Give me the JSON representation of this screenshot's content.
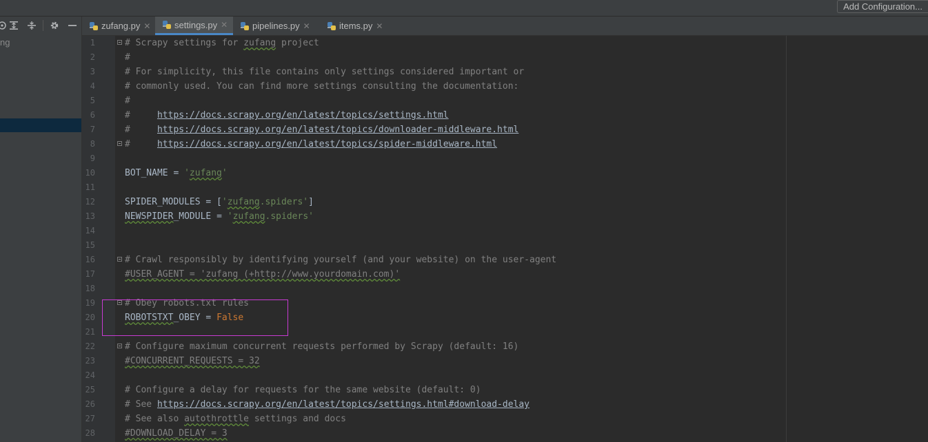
{
  "window": {
    "add_config_label": "Add Configuration..."
  },
  "sidebar": {
    "truncated_label": "ng"
  },
  "tabs": [
    {
      "label": "zufang.py",
      "active": false
    },
    {
      "label": "settings.py",
      "active": true
    },
    {
      "label": "pipelines.py",
      "active": false
    },
    {
      "label": "items.py",
      "active": false
    }
  ],
  "icons": {
    "tab_file": "python-file-icon",
    "tab_close": "close-icon",
    "toolbar": [
      "locate-icon",
      "expand-all-icon",
      "collapse-all-icon",
      "gear-icon",
      "minimize-icon"
    ]
  },
  "colors": {
    "comment": "#808080",
    "string": "#6a8759",
    "keyword": "#cc7832",
    "identifier": "#a9b7c6",
    "highlight_box": "#c93bd4"
  },
  "editor": {
    "lines": [
      {
        "n": "1",
        "segs": [
          [
            "c",
            "# Scrapy settings for "
          ],
          [
            "csq",
            "zufang"
          ],
          [
            "c",
            " project"
          ]
        ]
      },
      {
        "n": "2",
        "segs": [
          [
            "c",
            "#"
          ]
        ]
      },
      {
        "n": "3",
        "segs": [
          [
            "c",
            "# For simplicity, this file contains only settings considered important or"
          ]
        ]
      },
      {
        "n": "4",
        "segs": [
          [
            "c",
            "# commonly used. You can find more settings consulting the documentation:"
          ]
        ]
      },
      {
        "n": "5",
        "segs": [
          [
            "c",
            "#"
          ]
        ]
      },
      {
        "n": "6",
        "segs": [
          [
            "c",
            "#     "
          ],
          [
            "u",
            "https://docs.scrapy.org/en/latest/topics/settings.html"
          ]
        ]
      },
      {
        "n": "7",
        "segs": [
          [
            "c",
            "#     "
          ],
          [
            "u",
            "https://docs.scrapy.org/en/latest/topics/downloader-middleware.html"
          ]
        ]
      },
      {
        "n": "8",
        "segs": [
          [
            "c",
            "#     "
          ],
          [
            "u",
            "https://docs.scrapy.org/en/latest/topics/spider-middleware.html"
          ]
        ]
      },
      {
        "n": "9",
        "segs": []
      },
      {
        "n": "10",
        "segs": [
          [
            "i",
            "BOT_NAME = "
          ],
          [
            "s",
            "'"
          ],
          [
            "ssq",
            "zufang"
          ],
          [
            "s",
            "'"
          ]
        ]
      },
      {
        "n": "11",
        "segs": []
      },
      {
        "n": "12",
        "segs": [
          [
            "i",
            "SPIDER_MODULES = ["
          ],
          [
            "s",
            "'"
          ],
          [
            "ssq",
            "zufang"
          ],
          [
            "s",
            ".spiders'"
          ],
          [
            "i",
            "]"
          ]
        ]
      },
      {
        "n": "13",
        "segs": [
          [
            "isq",
            "NEWSPIDER"
          ],
          [
            "i",
            "_MODULE = "
          ],
          [
            "s",
            "'"
          ],
          [
            "ssq",
            "zufang"
          ],
          [
            "s",
            ".spiders'"
          ]
        ]
      },
      {
        "n": "14",
        "segs": []
      },
      {
        "n": "15",
        "segs": []
      },
      {
        "n": "16",
        "segs": [
          [
            "c",
            "# Crawl responsibly by identifying yourself (and your website) on the user-agent"
          ]
        ]
      },
      {
        "n": "17",
        "segs": [
          [
            "csq",
            "#USER_AGENT = 'zufang (+http://www.yourdomain.com)'"
          ]
        ]
      },
      {
        "n": "18",
        "segs": []
      },
      {
        "n": "19",
        "segs": [
          [
            "c",
            "# Obey robots.txt rules"
          ]
        ]
      },
      {
        "n": "20",
        "segs": [
          [
            "isq",
            "ROBOTSTXT"
          ],
          [
            "i",
            "_OBEY = "
          ],
          [
            "k",
            "False"
          ]
        ]
      },
      {
        "n": "21",
        "segs": []
      },
      {
        "n": "22",
        "segs": [
          [
            "c",
            "# Configure maximum concurrent requests performed by Scrapy (default: 16)"
          ]
        ]
      },
      {
        "n": "23",
        "segs": [
          [
            "csq",
            "#CONCURRENT_REQUESTS = 32"
          ]
        ]
      },
      {
        "n": "24",
        "segs": []
      },
      {
        "n": "25",
        "segs": [
          [
            "c",
            "# Configure a delay for requests for the same website (default: 0)"
          ]
        ]
      },
      {
        "n": "26",
        "segs": [
          [
            "c",
            "# See "
          ],
          [
            "u",
            "https://docs.scrapy.org/en/latest/topics/settings.html#download-delay"
          ]
        ]
      },
      {
        "n": "27",
        "segs": [
          [
            "c",
            "# See also "
          ],
          [
            "csq",
            "autothrottle"
          ],
          [
            "c",
            " settings and docs"
          ]
        ]
      },
      {
        "n": "28",
        "segs": [
          [
            "csq",
            "#DOWNLOAD_DELAY = 3"
          ]
        ]
      }
    ]
  }
}
